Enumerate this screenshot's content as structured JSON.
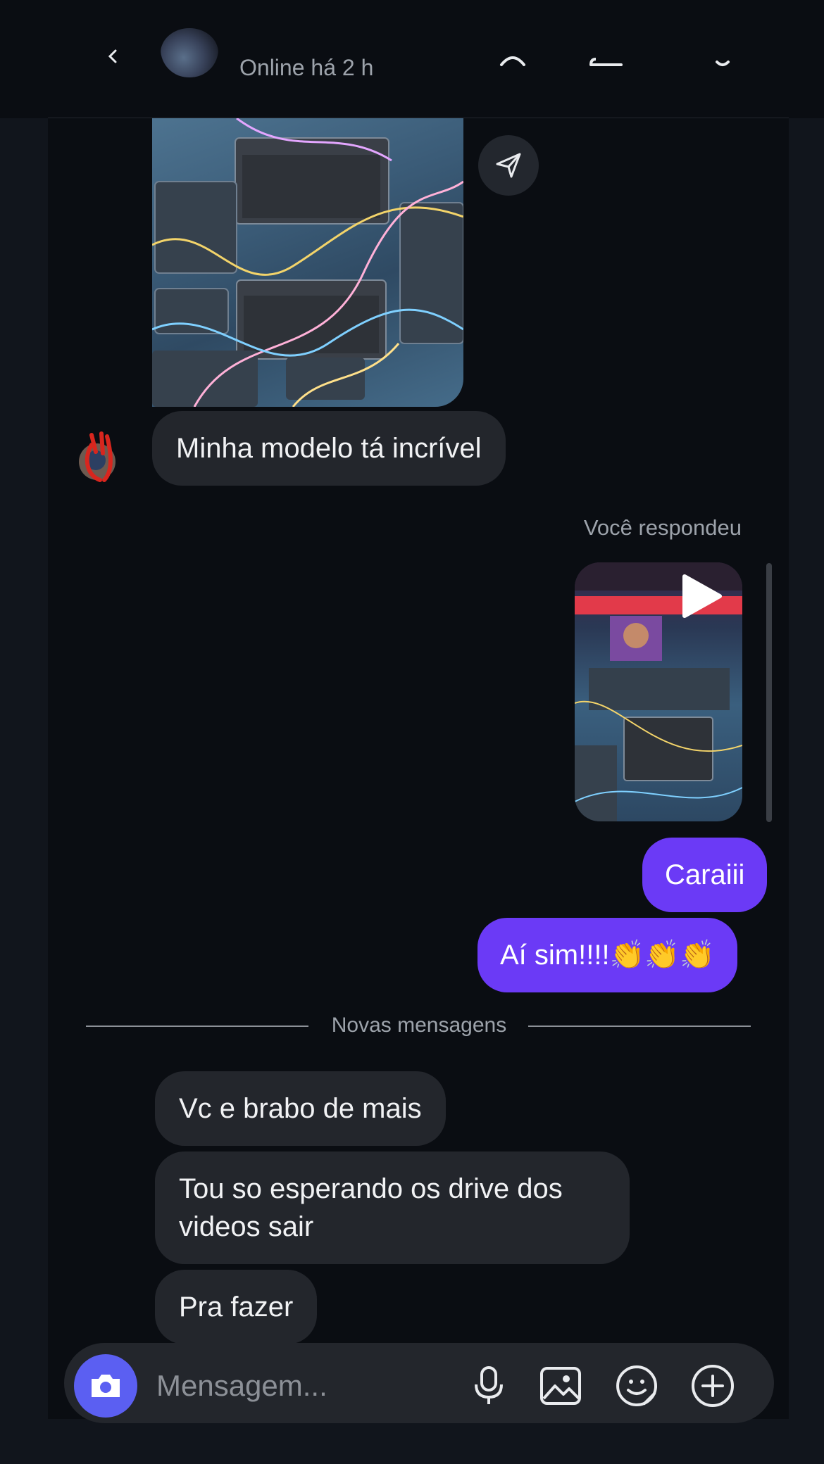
{
  "header": {
    "status": "Online há 2 h"
  },
  "messages": {
    "incoming_1": "Minha modelo tá incrível",
    "reply_label": "Você respondeu",
    "outgoing_1": "Caraiii",
    "outgoing_2": "Aí sim!!!!👏👏👏",
    "new_messages_label": "Novas mensagens",
    "incoming_2": "Vc e brabo de mais",
    "incoming_3": "Tou so esperando os drive dos videos sair",
    "incoming_4": "Pra fazer"
  },
  "composer": {
    "placeholder": "Mensagem..."
  },
  "colors": {
    "outgoing_bubble": "#6b3af6",
    "incoming_bubble": "#23262c",
    "camera_button": "#5b5ff2",
    "background": "#0a0d12"
  },
  "icons": [
    "back-arrow-icon",
    "call-icon",
    "video-call-icon",
    "menu-icon",
    "send-share-icon",
    "play-icon",
    "camera-icon",
    "microphone-icon",
    "image-icon",
    "sticker-icon",
    "add-icon"
  ]
}
